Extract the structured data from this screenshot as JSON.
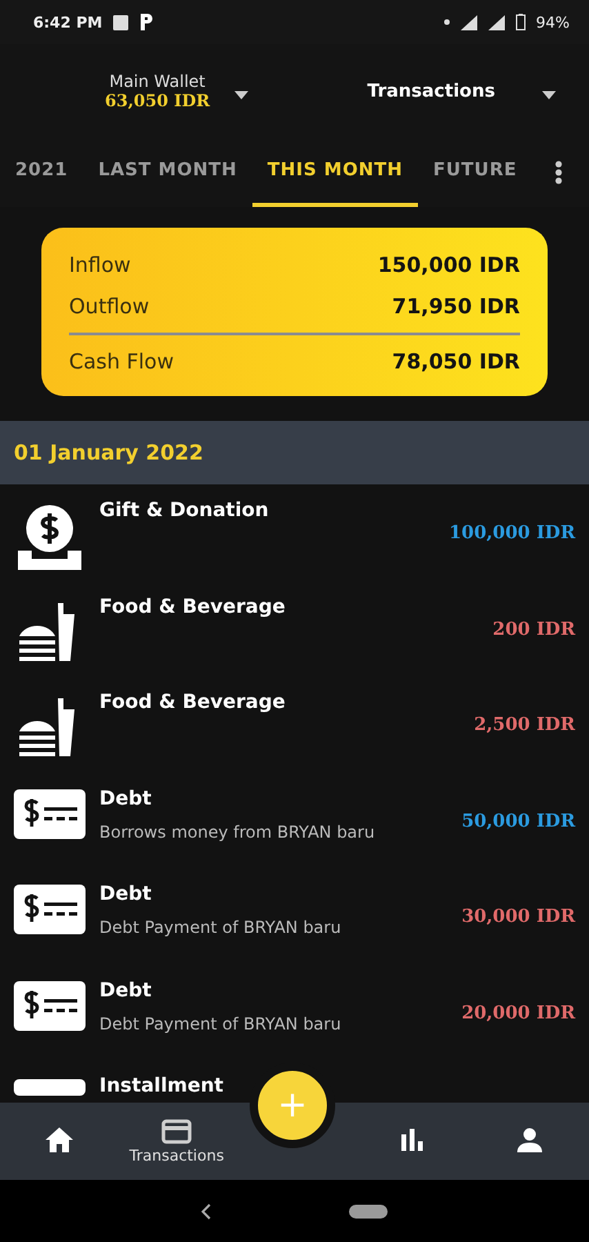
{
  "status_bar": {
    "time": "6:42 PM",
    "battery": "94%"
  },
  "header": {
    "wallet_name": "Main Wallet",
    "wallet_balance": "63,050 IDR",
    "view": "Transactions"
  },
  "tabs": [
    {
      "label": "2021",
      "selected": false
    },
    {
      "label": "LAST MONTH",
      "selected": false
    },
    {
      "label": "THIS MONTH",
      "selected": true
    },
    {
      "label": "FUTURE",
      "selected": false
    }
  ],
  "summary": {
    "rows": [
      {
        "label": "Inflow",
        "value": "150,000 IDR"
      },
      {
        "label": "Outflow",
        "value": "71,950 IDR"
      }
    ],
    "total": {
      "label": "Cash Flow",
      "value": "78,050 IDR"
    }
  },
  "date_header": "01 January 2022",
  "transactions": [
    {
      "kind": "gift",
      "title": "Gift & Donation",
      "amount": "100,000 IDR",
      "color": "#2b9be0"
    },
    {
      "kind": "food",
      "title": "Food & Beverage",
      "amount": "200 IDR",
      "color": "#e06a6a"
    },
    {
      "kind": "food",
      "title": "Food & Beverage",
      "amount": "2,500 IDR",
      "color": "#e06a6a"
    },
    {
      "kind": "debt",
      "title": "Debt",
      "note": "Borrows money from BRYAN baru",
      "amount": "50,000 IDR",
      "color": "#2b9be0"
    },
    {
      "kind": "debt",
      "title": "Debt",
      "note": "Debt Payment of BRYAN baru",
      "amount": "30,000 IDR",
      "color": "#e06a6a"
    },
    {
      "kind": "debt",
      "title": "Debt",
      "note": "Debt Payment of BRYAN baru",
      "amount": "20,000 IDR",
      "color": "#e06a6a"
    },
    {
      "kind": "installment",
      "title": "Installment"
    }
  ],
  "fab": {
    "symbol": "+"
  },
  "bottom_nav": [
    {
      "kind": "home",
      "selected": false
    },
    {
      "kind": "transactions",
      "label": "Transactions",
      "selected": true
    },
    {
      "kind": "stats",
      "selected": false
    },
    {
      "kind": "profile",
      "selected": false
    }
  ]
}
